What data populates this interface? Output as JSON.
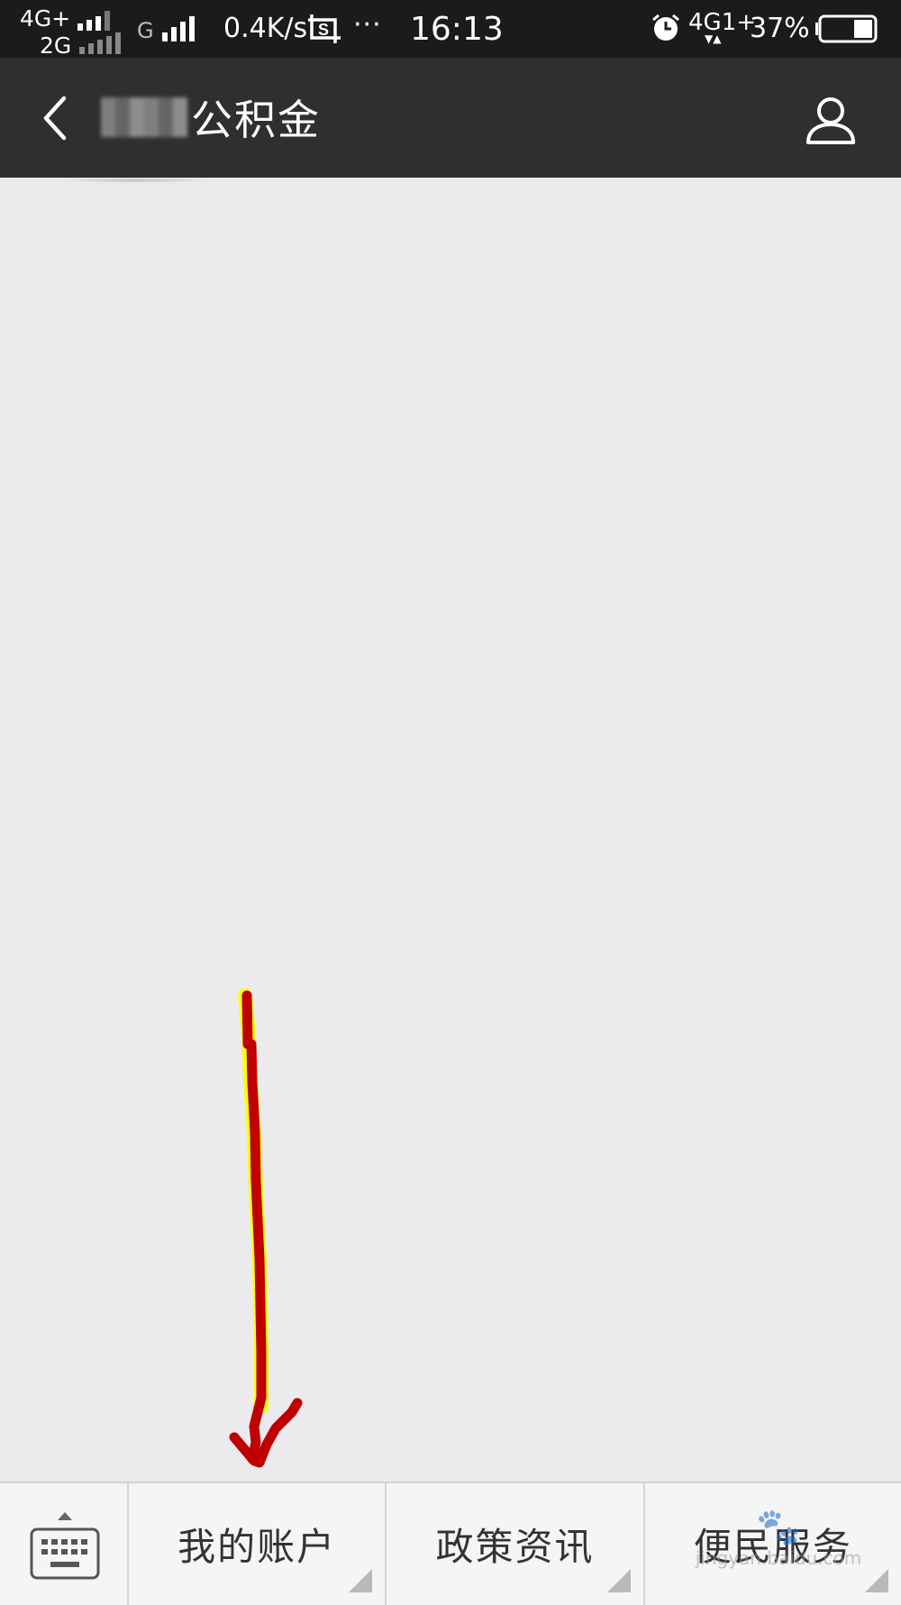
{
  "status_bar": {
    "network_1": "4G+",
    "network_2": "2G",
    "network_3": "G",
    "net_speed": "0.4K/s",
    "more": "···",
    "time": "16:13",
    "network_4": "4G1+",
    "network_4_arrows": "▼▲",
    "battery_percent": "37%",
    "battery_level": 0.37
  },
  "nav": {
    "back_icon": "chevron-left",
    "title": "公积金",
    "profile_icon": "person-outline"
  },
  "bottom_menu": {
    "keyboard_icon": "keyboard",
    "items": [
      {
        "label": "我的账户"
      },
      {
        "label": "政策资讯"
      },
      {
        "label": "便民服务"
      }
    ]
  },
  "watermark": {
    "text": "jingyan.baidu.com"
  },
  "colors": {
    "status_bar_bg": "#1b1b1b",
    "nav_bg": "#2f2f2f",
    "content_bg": "#ebebed",
    "menu_bg": "#f5f5f6",
    "annotation_arrow": "#c00000",
    "annotation_highlight": "#ffff00"
  }
}
